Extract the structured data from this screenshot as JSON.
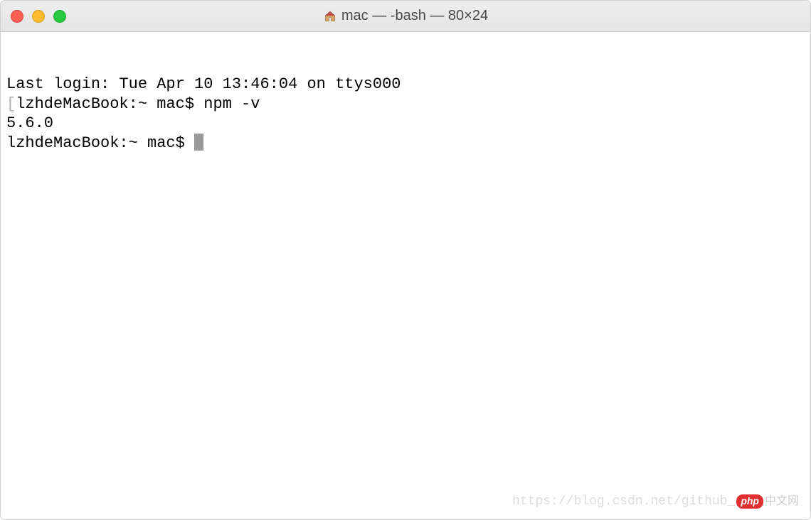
{
  "window": {
    "title": "mac — -bash — 80×24"
  },
  "terminal": {
    "lines": {
      "last_login": "Last login: Tue Apr 10 13:46:04 on ttys000",
      "prompt1_host": "lzhdeMacBook:~ mac$ ",
      "prompt1_cmd": "npm -v",
      "output1": "5.6.0",
      "prompt2_host": "lzhdeMacBook:~ mac$ "
    }
  },
  "watermark": {
    "url": "https://blog.csdn.net/github_",
    "badge": "php",
    "cn": "中文网"
  }
}
